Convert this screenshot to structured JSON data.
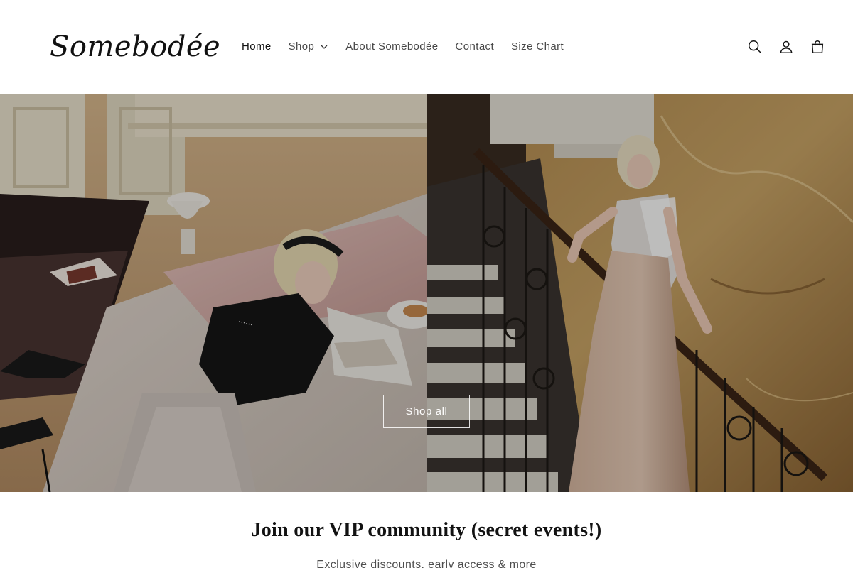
{
  "header": {
    "logo_text": "Somebodée",
    "nav": [
      {
        "label": "Home",
        "active": true
      },
      {
        "label": "Shop",
        "has_dropdown": true
      },
      {
        "label": "About Somebodée"
      },
      {
        "label": "Contact"
      },
      {
        "label": "Size Chart"
      }
    ],
    "icons": [
      "search-icon",
      "account-icon",
      "cart-icon"
    ]
  },
  "hero": {
    "button_label": "Shop all",
    "left_image": "woman-lying-on-bed-reading",
    "right_image": "woman-on-marble-staircase"
  },
  "newsletter": {
    "title": "Join our VIP community (secret events!)",
    "subtitle": "Exclusive discounts, early access & more"
  },
  "colors": {
    "text": "#121212",
    "background": "#ffffff",
    "button_border": "#ffffff"
  }
}
